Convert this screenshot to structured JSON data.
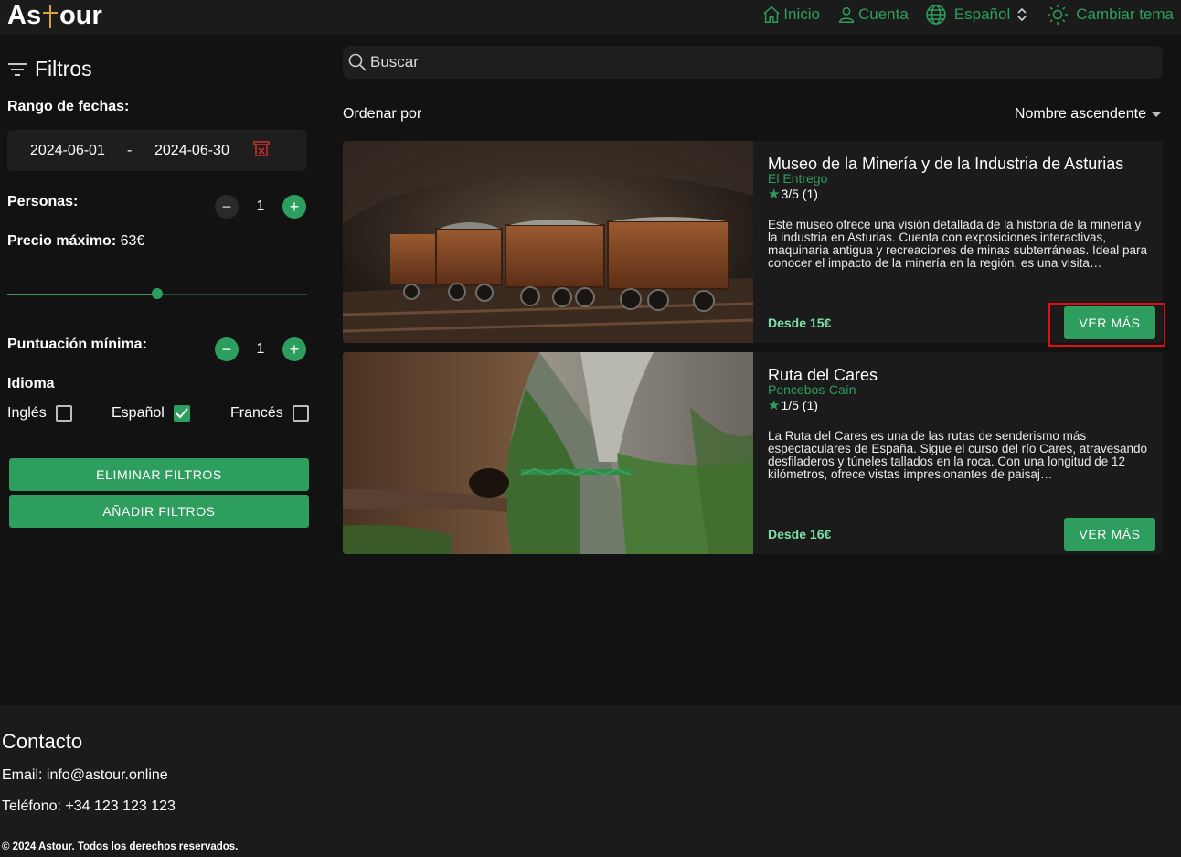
{
  "header": {
    "logo_left": "As",
    "logo_right": "our",
    "nav": {
      "home": "Inicio",
      "account": "Cuenta",
      "language": "Español",
      "theme": "Cambiar tema"
    }
  },
  "sidebar": {
    "title": "Filtros",
    "date_range_label": "Rango de fechas:",
    "date_start": "2024-06-01",
    "date_sep": "-",
    "date_end": "2024-06-30",
    "people_label": "Personas:",
    "people_value": "1",
    "max_price_label": "Precio máximo:",
    "max_price_value": "63€",
    "max_price_fraction": 0.5,
    "min_rating_label": "Puntuación mínima:",
    "min_rating_value": "1",
    "language_label": "Idioma",
    "languages": [
      {
        "label": "Inglés",
        "checked": false
      },
      {
        "label": "Español",
        "checked": true
      },
      {
        "label": "Francés",
        "checked": false
      }
    ],
    "clear_button": "ELIMINAR FILTROS",
    "add_button": "AÑADIR FILTROS"
  },
  "main": {
    "search_placeholder": "Buscar",
    "order_label": "Ordenar por",
    "order_value": "Nombre ascendente",
    "cards": [
      {
        "title": "Museo de la Minería y de la Industria de Asturias",
        "location": "El Entrego",
        "rating": "3/5 (1)",
        "description": "Este museo ofrece una visión detallada de la historia de la minería y la industria en Asturias. Cuenta con exposiciones interactivas, maquinaria antigua y recreaciones de minas subterráneas. Ideal para conocer el impacto de la minería en la región, es una visita…",
        "price": "Desde 15€",
        "button": "VER MÁS"
      },
      {
        "title": "Ruta del Cares",
        "location": "Poncebos-Caín",
        "rating": "1/5 (1)",
        "description": "La Ruta del Cares es una de las rutas de senderismo más espectaculares de España. Sigue el curso del río Cares, atravesando desfiladeros y túneles tallados en la roca. Con una longitud de 12 kilómetros, ofrece vistas impresionantes de paisaj…",
        "price": "Desde 16€",
        "button": "VER MÁS"
      }
    ]
  },
  "footer": {
    "title": "Contacto",
    "email": "Email: info@astour.online",
    "phone": "Teléfono: +34 123 123 123",
    "copyright": "© 2024 Astour. Todos los derechos reservados."
  },
  "colors": {
    "accent": "#2e9e5e",
    "background": "#121212",
    "panel": "#1b1b1b",
    "highlight": "#e01010"
  }
}
